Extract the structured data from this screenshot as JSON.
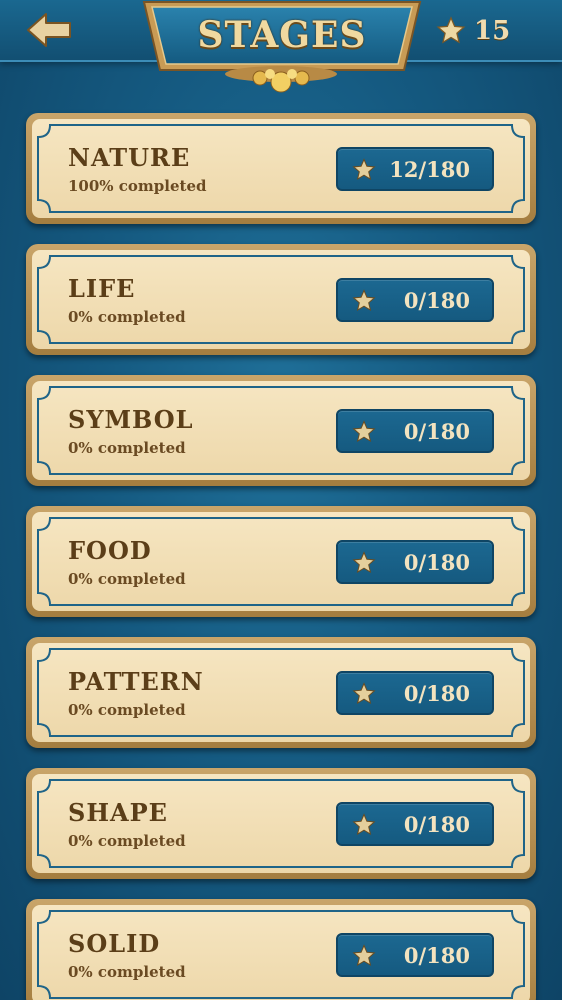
{
  "header": {
    "title": "STAGES",
    "back_icon": "arrow-left-icon",
    "total_stars": "15"
  },
  "colors": {
    "background": "#155a81",
    "card": "#f1deb6",
    "card_border": "#b58c4c",
    "badge": "#1a6189",
    "title_text": "#f0d9a0",
    "label_text": "#5b3e18"
  },
  "stages": [
    {
      "name": "NATURE",
      "progress": "100% completed",
      "stars": "12/180"
    },
    {
      "name": "LIFE",
      "progress": "0% completed",
      "stars": "0/180"
    },
    {
      "name": "SYMBOL",
      "progress": "0% completed",
      "stars": "0/180"
    },
    {
      "name": "FOOD",
      "progress": "0% completed",
      "stars": "0/180"
    },
    {
      "name": "PATTERN",
      "progress": "0% completed",
      "stars": "0/180"
    },
    {
      "name": "SHAPE",
      "progress": "0% completed",
      "stars": "0/180"
    },
    {
      "name": "SOLID",
      "progress": "0% completed",
      "stars": "0/180"
    }
  ]
}
